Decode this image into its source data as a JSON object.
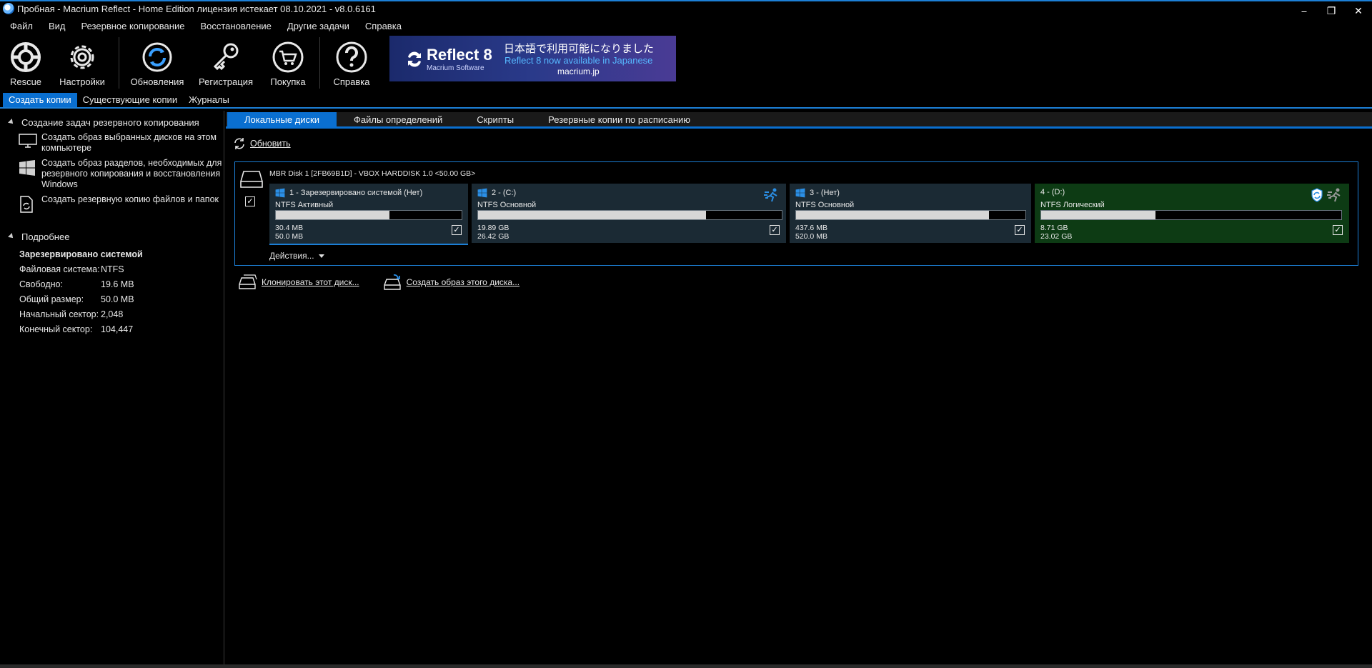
{
  "window": {
    "title": "Пробная - Macrium Reflect - Home Edition лицензия истекает 08.10.2021 - v8.0.6161",
    "minimize": "⎯",
    "restore": "❐",
    "close": "✕"
  },
  "menu": [
    "Файл",
    "Вид",
    "Резервное копирование",
    "Восстановление",
    "Другие задачи",
    "Справка"
  ],
  "toolbar": {
    "rescue": "Rescue",
    "settings": "Настройки",
    "updates": "Обновления",
    "registration": "Регистрация",
    "purchase": "Покупка",
    "help": "Справка"
  },
  "banner": {
    "product": "Reflect 8",
    "company": "Macrium Software",
    "jp_text": "日本語で利用可能になりました",
    "en_text": "Reflect 8 now available in Japanese",
    "url": "macrium.jp"
  },
  "main_tabs": [
    "Создать копии",
    "Существующие копии",
    "Журналы"
  ],
  "left": {
    "tasks_header": "Создание задач резервного копирования",
    "tasks": [
      "Создать образ выбранных дисков на этом компьютере",
      "Создать образ разделов, необходимых для резервного копирования и восстановления Windows",
      "Создать резервную копию файлов и папок"
    ],
    "details_header": "Подробнее",
    "details_title": "Зарезервировано системой",
    "details": [
      {
        "k": "Файловая система:",
        "v": "NTFS"
      },
      {
        "k": "Свободно:",
        "v": "19.6 MB"
      },
      {
        "k": "Общий размер:",
        "v": "50.0 MB"
      },
      {
        "k": "Начальный сектор:",
        "v": "2,048"
      },
      {
        "k": "Конечный сектор:",
        "v": "104,447"
      }
    ]
  },
  "sub_tabs": [
    "Локальные диски",
    "Файлы определений",
    "Скрипты",
    "Резервные копии по расписанию"
  ],
  "refresh": "Обновить",
  "disk": {
    "title": "MBR Disk 1 [2FB69B1D] - VBOX HARDDISK 1.0  <50.00 GB>",
    "actions": "Действия...",
    "partitions": [
      {
        "name": "1 - Зарезервировано системой (Нет)",
        "type": "NTFS Активный",
        "used": "30.4 MB",
        "total": "50.0 MB",
        "fill": 0.61,
        "logical": false
      },
      {
        "name": "2 -  (C:)",
        "type": "NTFS Основной",
        "used": "19.89 GB",
        "total": "26.42 GB",
        "fill": 0.75,
        "logical": false
      },
      {
        "name": "3 -  (Нет)",
        "type": "NTFS Основной",
        "used": "437.6 MB",
        "total": "520.0 MB",
        "fill": 0.84,
        "logical": false
      },
      {
        "name": "4 -  (D:)",
        "type": "NTFS Логический",
        "used": "8.71 GB",
        "total": "23.02 GB",
        "fill": 0.38,
        "logical": true
      }
    ]
  },
  "links": {
    "clone": "Клонировать этот диск...",
    "image": "Создать образ этого диска..."
  },
  "colors": {
    "accent": "#1c7fd6",
    "partition_bg": "#1b2a34",
    "logical_bg": "#0d3b14"
  }
}
